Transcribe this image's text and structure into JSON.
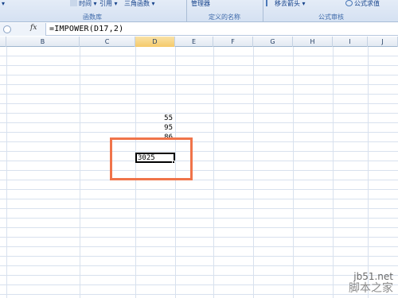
{
  "ribbon": {
    "formula_lib": {
      "item_left": "▾",
      "time_label": "时间",
      "ref_label": "引用",
      "trig_label": "三角函数",
      "group_label": "函数库"
    },
    "defined_names": {
      "manager_label": "管理器",
      "group_label": "定义的名称"
    },
    "audit": {
      "remove_arrows_label": "移去箭头",
      "evaluate_label": "公式求值",
      "group_label": "公式审核"
    }
  },
  "formula_bar": {
    "fx": "fx",
    "formula": "=IMPOWER(D17,2)"
  },
  "columns": [
    "B",
    "C",
    "D",
    "E",
    "F",
    "G",
    "H",
    "I",
    "J"
  ],
  "active_column": "D",
  "cells": {
    "d1": "55",
    "d2": "95",
    "d3": "86",
    "active_value": "3025"
  },
  "watermark": {
    "site": "jb51.net",
    "name": "脚本之家"
  },
  "colors": {
    "highlight": "#f0744a",
    "grid": "#d8e1ee"
  }
}
